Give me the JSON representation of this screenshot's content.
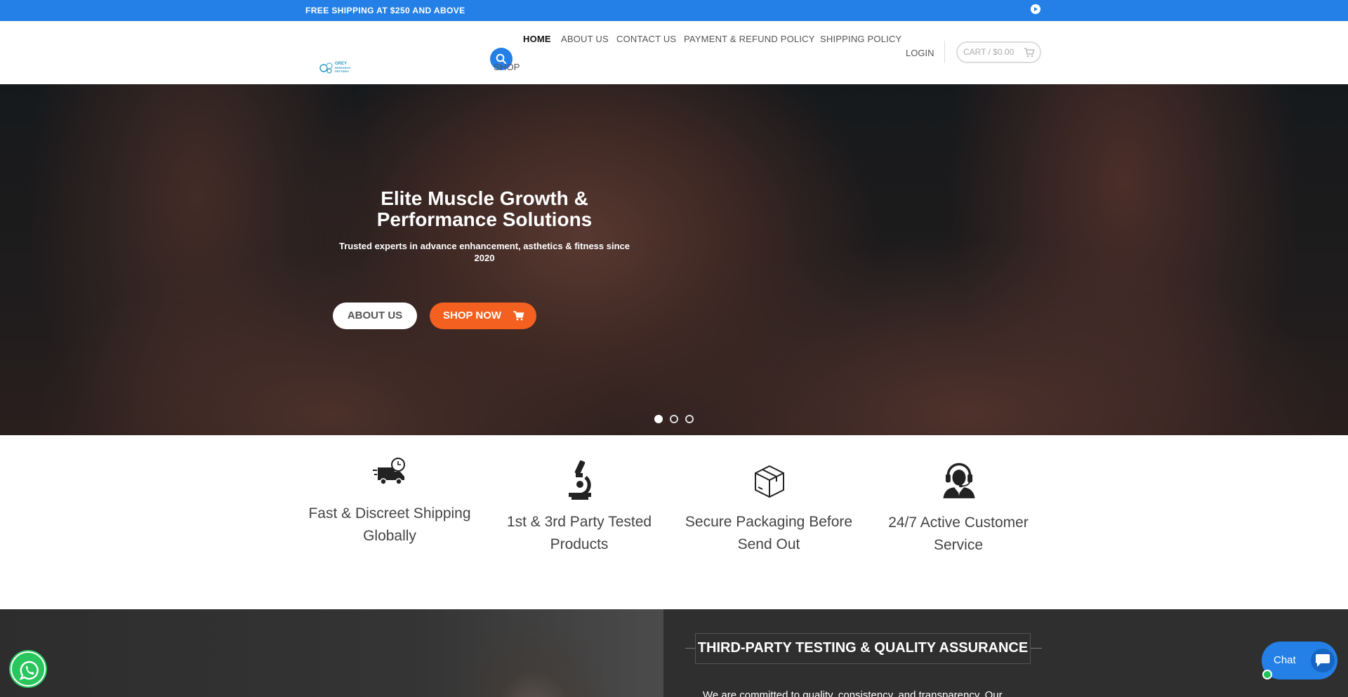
{
  "topbar": {
    "text": "FREE SHIPPING AT $250 AND ABOVE",
    "close_icon": "close-circle-icon"
  },
  "header": {
    "logo_text_line1": "GREY",
    "logo_text_line2": "RESEARCH",
    "logo_text_line3": "PEPTIDES",
    "nav": [
      {
        "label": "HOME",
        "active": true
      },
      {
        "label": "ABOUT US",
        "active": false
      },
      {
        "label": "CONTACT US",
        "active": false
      },
      {
        "label": "PAYMENT & REFUND POLICY",
        "active": false
      },
      {
        "label": "SHIPPING POLICY",
        "active": false
      },
      {
        "label": "SHOP",
        "active": false
      }
    ],
    "login": "LOGIN",
    "cart": "CART / $0.00"
  },
  "hero": {
    "title": "Elite Muscle Growth & Performance Solutions",
    "subtitle": "Trusted experts in advance enhancement, asthetics & fitness since 2020",
    "about_button": "ABOUT US",
    "shop_button": "SHOP NOW",
    "slides": 3,
    "active_slide": 1
  },
  "features": [
    {
      "icon": "delivery-truck-icon",
      "label": "Fast & Discreet Shipping Globally"
    },
    {
      "icon": "microscope-icon",
      "label": "1st & 3rd Party Tested Products"
    },
    {
      "icon": "package-box-icon",
      "label": "Secure Packaging Before Send Out"
    },
    {
      "icon": "headset-support-icon",
      "label": "24/7 Active Customer Service"
    }
  ],
  "quality": {
    "title": "THIRD-PARTY TESTING & QUALITY ASSURANCE",
    "text": "We are committed to quality, consistency, and transparency. Our"
  },
  "chat": {
    "label": "Chat"
  },
  "colors": {
    "primary": "#2480e6",
    "accent": "#f4601f",
    "dark": "#2f2f2f",
    "whatsapp": "#28c65c"
  }
}
